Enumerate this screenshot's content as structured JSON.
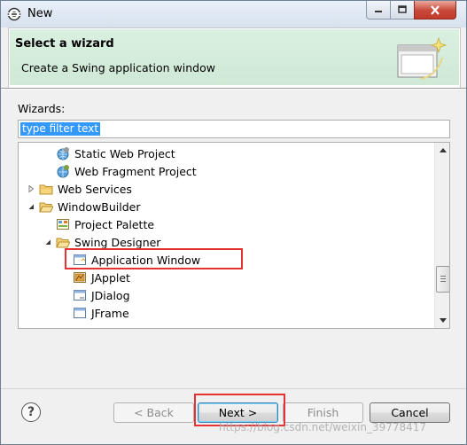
{
  "window": {
    "title": "New"
  },
  "header": {
    "title": "Select a wizard",
    "description": "Create a Swing application window"
  },
  "wizards_label": "Wizards:",
  "filter": {
    "value": "type filter text"
  },
  "tree": {
    "items": [
      {
        "label": "Static Web Project",
        "icon": "web-project-icon",
        "expander": "none"
      },
      {
        "label": "Web Fragment Project",
        "icon": "web-fragment-icon",
        "expander": "none"
      },
      {
        "label": "Web Services",
        "icon": "folder-icon",
        "expander": "collapsed"
      },
      {
        "label": "WindowBuilder",
        "icon": "folder-icon",
        "expander": "expanded"
      },
      {
        "label": "Project Palette",
        "icon": "palette-icon",
        "expander": "none"
      },
      {
        "label": "Swing Designer",
        "icon": "folder-icon",
        "expander": "expanded"
      },
      {
        "label": "Application Window",
        "icon": "window-icon",
        "expander": "none"
      },
      {
        "label": "JApplet",
        "icon": "applet-icon",
        "expander": "none"
      },
      {
        "label": "JDialog",
        "icon": "dialog-icon",
        "expander": "none"
      },
      {
        "label": "JFrame",
        "icon": "frame-icon",
        "expander": "none"
      }
    ]
  },
  "buttons": {
    "back": "< Back",
    "next": "Next >",
    "finish": "Finish",
    "cancel": "Cancel"
  },
  "help_label": "?",
  "watermark": "https://blog.csdn.net/weixin_39778417",
  "colors": {
    "header_band": "#d3ecda",
    "highlight_box": "#e53232",
    "filter_selection": "#3399ff"
  }
}
